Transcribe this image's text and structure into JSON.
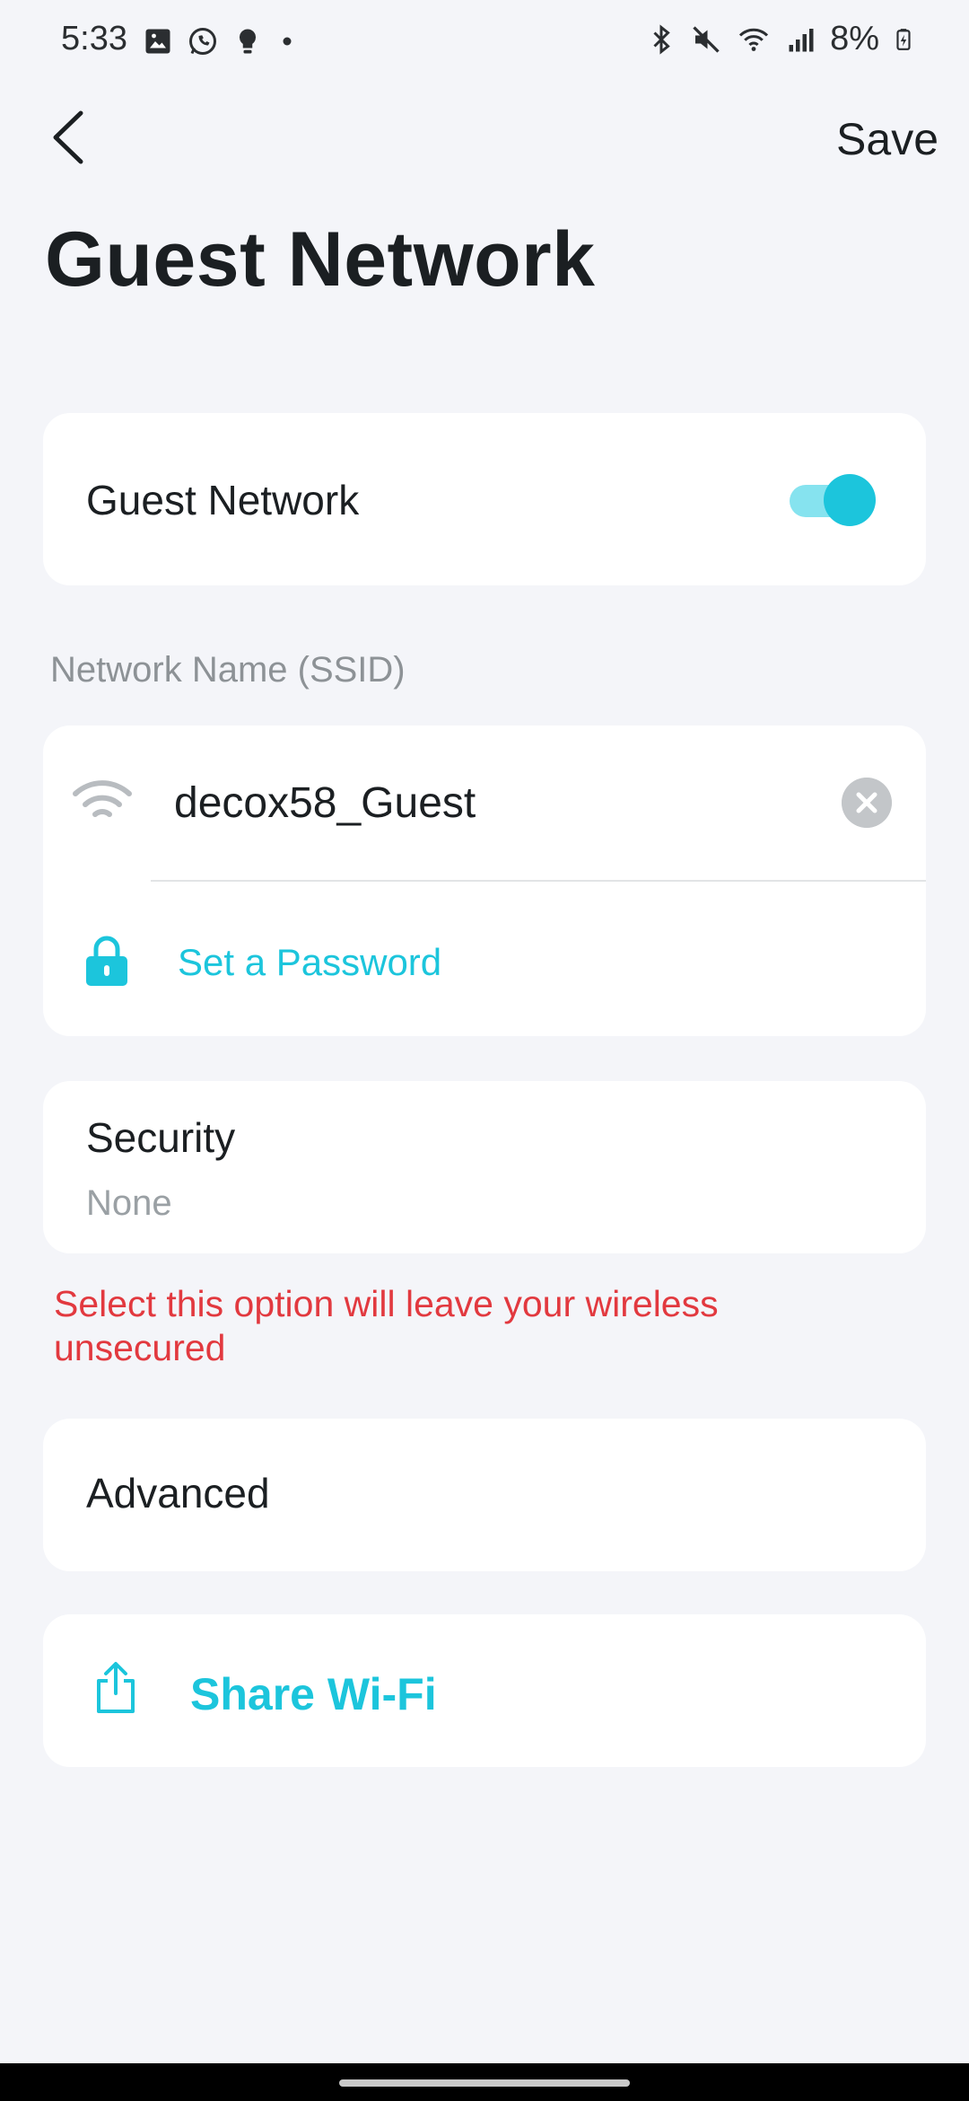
{
  "status_bar": {
    "time": "5:33",
    "battery": "8%",
    "left_icons": [
      "gallery-icon",
      "whatsapp-icon",
      "bulb-icon",
      "dot-icon"
    ],
    "right_icons": [
      "bluetooth-icon",
      "mute-icon",
      "wifi-icon",
      "signal-icon",
      "battery-icon"
    ]
  },
  "header": {
    "back_icon": "chevron-left-icon",
    "save_label": "Save",
    "title": "Guest Network"
  },
  "guest_toggle": {
    "label": "Guest Network",
    "enabled": true,
    "accent": "#1cc5dc"
  },
  "ssid_section": {
    "label": "Network Name (SSID)",
    "ssid_value": "decox58_Guest",
    "wifi_icon": "wifi-icon",
    "clear_icon": "clear-icon",
    "lock_icon": "lock-icon",
    "password_link": "Set a Password"
  },
  "security": {
    "title": "Security",
    "value": "None",
    "warning": "Select this option will leave your wireless unsecured",
    "warning_color": "#e2393f"
  },
  "advanced": {
    "title": "Advanced"
  },
  "share": {
    "icon": "share-icon",
    "label": "Share Wi-Fi"
  }
}
